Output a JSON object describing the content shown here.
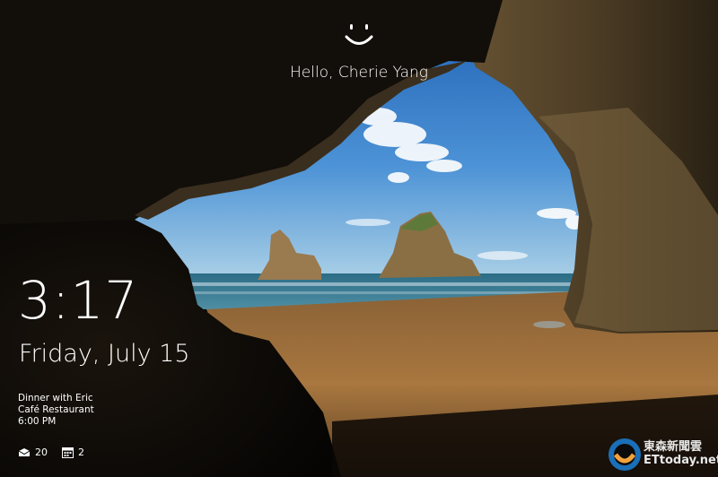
{
  "lockscreen": {
    "greeting": "Hello, Cherie Yang",
    "time": "3:17",
    "date": "Friday, July 15",
    "event": {
      "title": "Dinner with Eric",
      "location": "Café Restaurant",
      "time": "6:00 PM"
    },
    "badges": [
      {
        "icon": "mail-icon",
        "count": "20"
      },
      {
        "icon": "calendar-icon",
        "count": "2"
      }
    ]
  },
  "watermark": {
    "brand_cn": "東森新聞雲",
    "brand_en": "ETtoday.net"
  },
  "colors": {
    "sky": "#3a7fc8",
    "sea": "#2f6f86",
    "sand": "#a9743c",
    "rock": "#6e5a3a"
  }
}
